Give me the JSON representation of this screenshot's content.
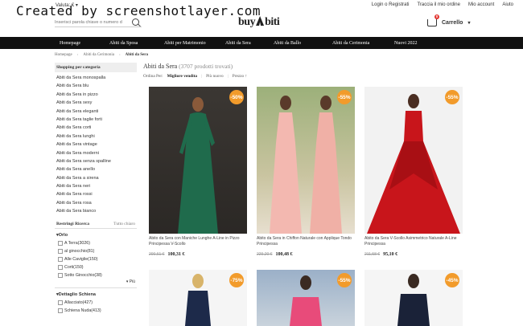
{
  "watermark": "Created by screenshotlayer.com",
  "header": {
    "valuta": "Valuta: € ▾",
    "links": [
      "Login o Registrati",
      "Traccia il mio ordine",
      "Mio account",
      "Aiuto"
    ],
    "search_placeholder": "Inserisci parola chiave o numero d",
    "logo_left": "buy",
    "logo_right": "biti",
    "cart_label": "Carrello",
    "cart_count": "0"
  },
  "nav": [
    "Homepage",
    "Abiti da Sposa",
    "Abiti per Matrimonio",
    "Abiti da Sera",
    "Abiti da Ballo",
    "Abiti da Cerimonia",
    "Nuovi 2022"
  ],
  "breadcrumb": [
    "Homepage",
    "Abiti da Cerimonia",
    "Abiti da Sera"
  ],
  "sidebar": {
    "title": "Shopping per categoria",
    "categories": [
      "Abiti da Sera monospalla",
      "Abiti da Sera blu",
      "Abiti da Sera in pizzo",
      "Abiti da Sera sexy",
      "Abiti da Sera eleganti",
      "Abiti da Sera taglie forti",
      "Abiti da Sera corti",
      "Abiti da Sera lunghi",
      "Abiti da Sera vintage",
      "Abiti da Sera moderni",
      "Abiti da Sera senza spalline",
      "Abiti da Sera aneIlo",
      "Abiti da Sera a sirena",
      "Abiti da Sera neri",
      "Abiti da Sera rossi",
      "Abiti da Sera rosa",
      "Abiti da Sera bianco"
    ],
    "refine_title": "Restringi Ricerca",
    "refine_clear": "Tutto chiaro",
    "filters": [
      {
        "title": "Orlo",
        "options": [
          "A Terra(3026)",
          "al ginocchio(81)",
          "Alle Caviglie(150)",
          "Corti(150)",
          "Sotto Ginocchio(38)"
        ],
        "more": "Più"
      },
      {
        "title": "Dettaglio Schiena",
        "options": [
          "Allacciato(427)",
          "Schiena Nuda(413)"
        ],
        "more": "Più"
      }
    ]
  },
  "main": {
    "title": "Abiti da Sera",
    "count": " (3707 prodotti trovati)",
    "sort_label": "Ordina Per:",
    "sort_options": [
      "Migliore vendita",
      "Più nuovo",
      "Prezzo ↑"
    ]
  },
  "products": [
    {
      "discount": "-50%",
      "name": "Abito da Sera con Maniche Lunghe A-Line in Pizzo Principessa V-Scollo",
      "old_price": "200,61 €",
      "new_price": "100,31 €",
      "color": "#1f6b4c"
    },
    {
      "discount": "-55%",
      "name": "Abito da Sera in Chiffon Naturale con Applique Tondo Principessa",
      "old_price": "229,20 €",
      "new_price": "100,48 €",
      "color": "#f3b8b0"
    },
    {
      "discount": "-55%",
      "name": "Abito da Sera V-Scollo Asimmetrico Naturale A-Line Principessa",
      "old_price": "211,58 €",
      "new_price": "95,10 €",
      "color": "#c8151b"
    },
    {
      "discount": "-75%",
      "color": "#1d2a4a"
    },
    {
      "discount": "-55%",
      "color": "#e84b7a"
    },
    {
      "discount": "-45%",
      "color": "#1a2238"
    }
  ]
}
